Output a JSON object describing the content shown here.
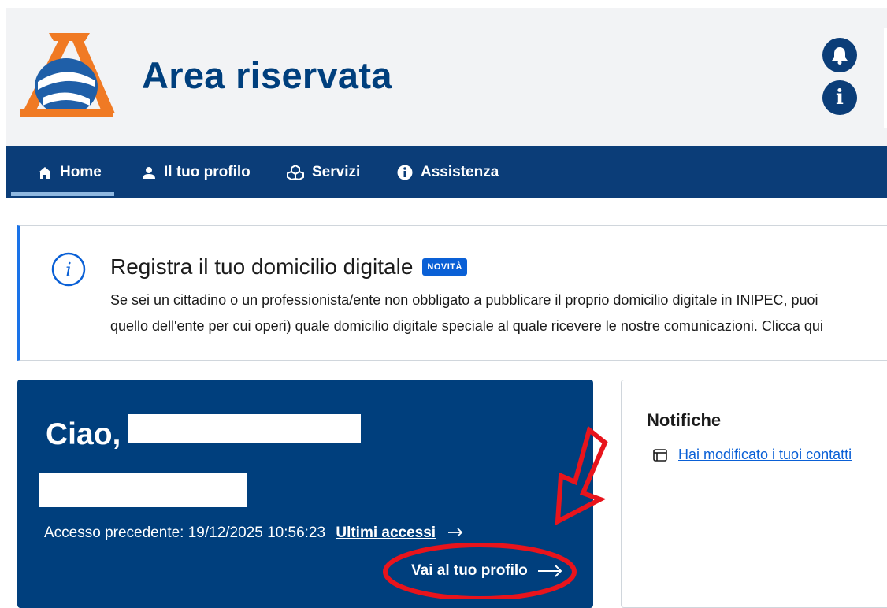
{
  "header": {
    "title": "Area riservata",
    "logo_icon": "agenzia-entrate-logo",
    "buttons": [
      {
        "icon": "bell-icon",
        "label": "Notifiche"
      },
      {
        "icon": "info-icon",
        "glyph": "i"
      }
    ]
  },
  "nav": {
    "items": [
      {
        "label": "Home",
        "icon": "home-icon",
        "active": true
      },
      {
        "label": "Il tuo profilo",
        "icon": "user-icon"
      },
      {
        "label": "Servizi",
        "icon": "services-icon"
      },
      {
        "label": "Assistenza",
        "icon": "info-icon"
      }
    ]
  },
  "banner": {
    "title": "Registra il tuo domicilio digitale",
    "badge": "NOVITÀ",
    "line1": "Se sei un cittadino o un professionista/ente non obbligato a pubblicare il proprio domicilio digitale in INIPEC, puoi",
    "line2": "quello dell'ente per cui operi) quale domicilio digitale speciale al quale ricevere le nostre comunicazioni. Clicca qui"
  },
  "welcome": {
    "greeting": "Ciao,",
    "last_access_label": "Accesso precedente: 19/12/2025 10:56:23",
    "last_access_link": "Ultimi accessi",
    "profile_link": "Vai al tuo profilo"
  },
  "notifications": {
    "title": "Notifiche",
    "items": [
      {
        "text": "Hai modificato i tuoi contatti",
        "icon": "window-icon"
      }
    ]
  },
  "colors": {
    "primary": "#0b3d78",
    "card": "#003f7d",
    "accent_link": "#0a60d6",
    "annotation": "#e8141c",
    "logo_orange": "#f07a24"
  }
}
